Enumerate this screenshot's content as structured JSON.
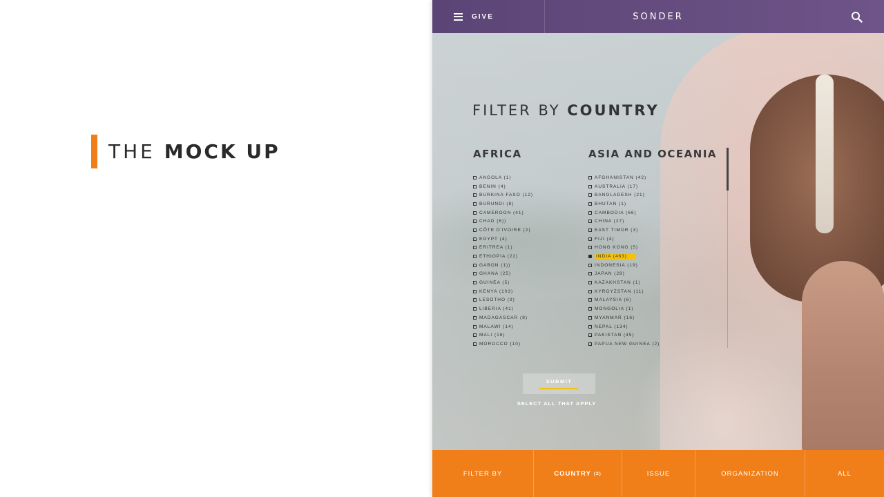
{
  "slide": {
    "title_light": "THE",
    "title_bold": "MOCK UP",
    "accent_color": "#f07f1a"
  },
  "header": {
    "menu_icon": "hamburger-icon",
    "give_label": "GIVE",
    "logo": "SONDER",
    "search_icon": "search-icon",
    "bar_color": "#5b4476"
  },
  "filter": {
    "heading_light": "FILTER BY",
    "heading_bold": "COUNTRY",
    "africa": {
      "heading": "AFRICA",
      "items": [
        "ANGOLA (1)",
        "BENIN (4)",
        "BURKINA FASO (12)",
        "BURUNDI (8)",
        "CAMEROON (41)",
        "CHAD (6))",
        "CÔTE D'IVOIRE (2)",
        "EGYPT (4)",
        "ERITREA (1)",
        "ETHIOPIA (22)",
        "GABON (1))",
        "GHANA (25)",
        "GUINEA (5)",
        "KENYA (103)",
        "LESOTHO (9)",
        "LIBERIA (41)",
        "MADAGASCAR (8)",
        "MALAWI (14)",
        "MALI (16)",
        "MOROCCO (10)"
      ]
    },
    "asia": {
      "heading": "ASIA AND OCEANIA",
      "items": [
        "AFGHANISTAN (42)",
        "AUSTRALIA (17)",
        "BANGLADESH (21)",
        "BHUTAN (1)",
        "CAMBODIA (66)",
        "CHINA (27)",
        "EAST TIMOR (3)",
        "FIJI (4)",
        "HONG KONG (5)",
        "INDIA (463)",
        "INDONESIA (19)",
        "JAPAN (28)",
        "KAZAKHSTAN (1)",
        "KYRGYZSTAN (11)",
        "MALAYSIA (6)",
        "MONGOLIA (1)",
        "MYANMAR (16)",
        "NEPAL (134)",
        "PAKISTAN (45)",
        "PAPUA NEW GUINEA (2)"
      ],
      "selected": "INDIA (463)"
    },
    "submit_label": "SUBMIT",
    "hint": "SELECT ALL THAT APPLY",
    "highlight_color": "#f5c20a"
  },
  "bottom_bar": {
    "filter_by": "FILTER BY",
    "country": "COUNTRY",
    "country_count": "(2)",
    "issue": "ISSUE",
    "organization": "ORGANIZATION",
    "all": "ALL",
    "bar_color": "#f07f1a"
  }
}
